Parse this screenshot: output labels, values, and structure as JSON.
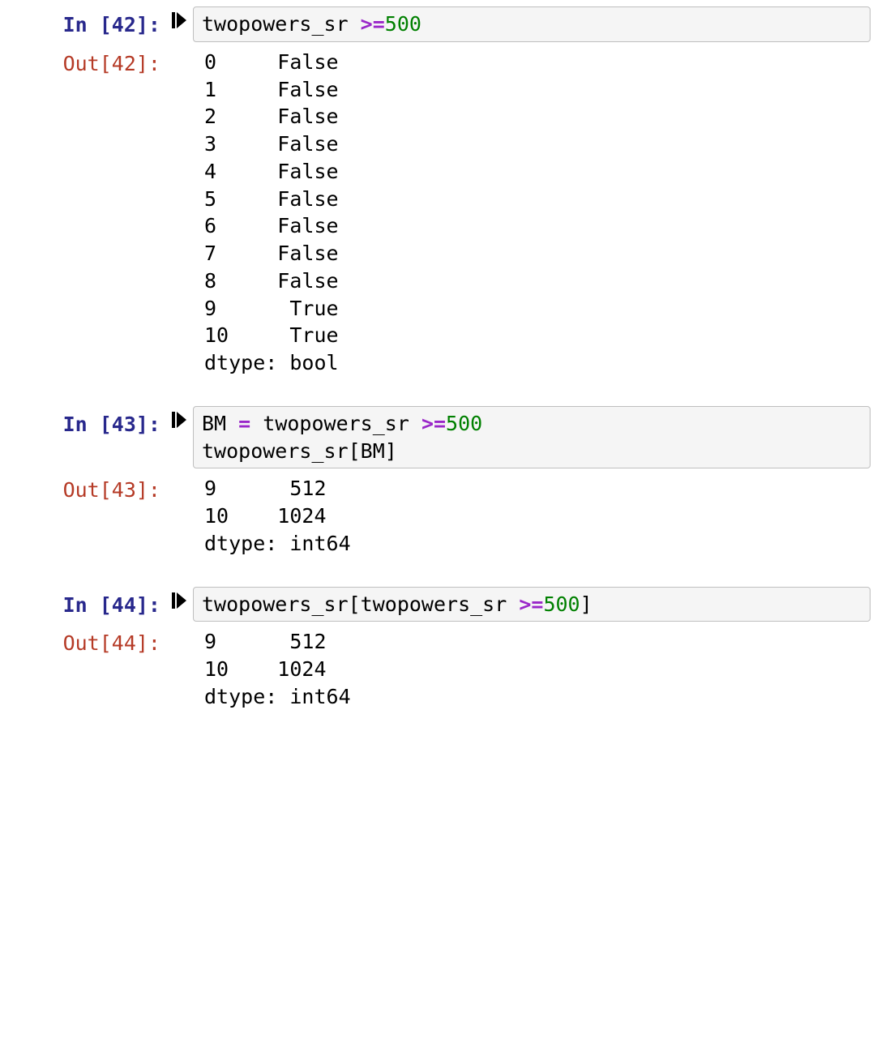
{
  "cells": [
    {
      "in_prompt": "In [42]:",
      "out_prompt": "Out[42]:",
      "code_tokens": [
        {
          "t": "twopowers_sr ",
          "c": ""
        },
        {
          "t": ">=",
          "c": "op"
        },
        {
          "t": "500",
          "c": "num"
        }
      ],
      "output": "0     False\n1     False\n2     False\n3     False\n4     False\n5     False\n6     False\n7     False\n8     False\n9      True\n10     True\ndtype: bool"
    },
    {
      "in_prompt": "In [43]:",
      "out_prompt": "Out[43]:",
      "code_tokens": [
        {
          "t": "BM ",
          "c": ""
        },
        {
          "t": "=",
          "c": "op"
        },
        {
          "t": " twopowers_sr ",
          "c": ""
        },
        {
          "t": ">=",
          "c": "op"
        },
        {
          "t": "500",
          "c": "num"
        },
        {
          "t": "\n",
          "c": ""
        },
        {
          "t": "twopowers_sr[BM]",
          "c": ""
        }
      ],
      "output": "9      512\n10    1024\ndtype: int64"
    },
    {
      "in_prompt": "In [44]:",
      "out_prompt": "Out[44]:",
      "code_tokens": [
        {
          "t": "twopowers_sr[twopowers_sr ",
          "c": ""
        },
        {
          "t": ">=",
          "c": "op"
        },
        {
          "t": "500",
          "c": "num"
        },
        {
          "t": "]",
          "c": ""
        }
      ],
      "output": "9      512\n10    1024\ndtype: int64"
    }
  ],
  "icons": {
    "run": "run-cell-icon"
  }
}
